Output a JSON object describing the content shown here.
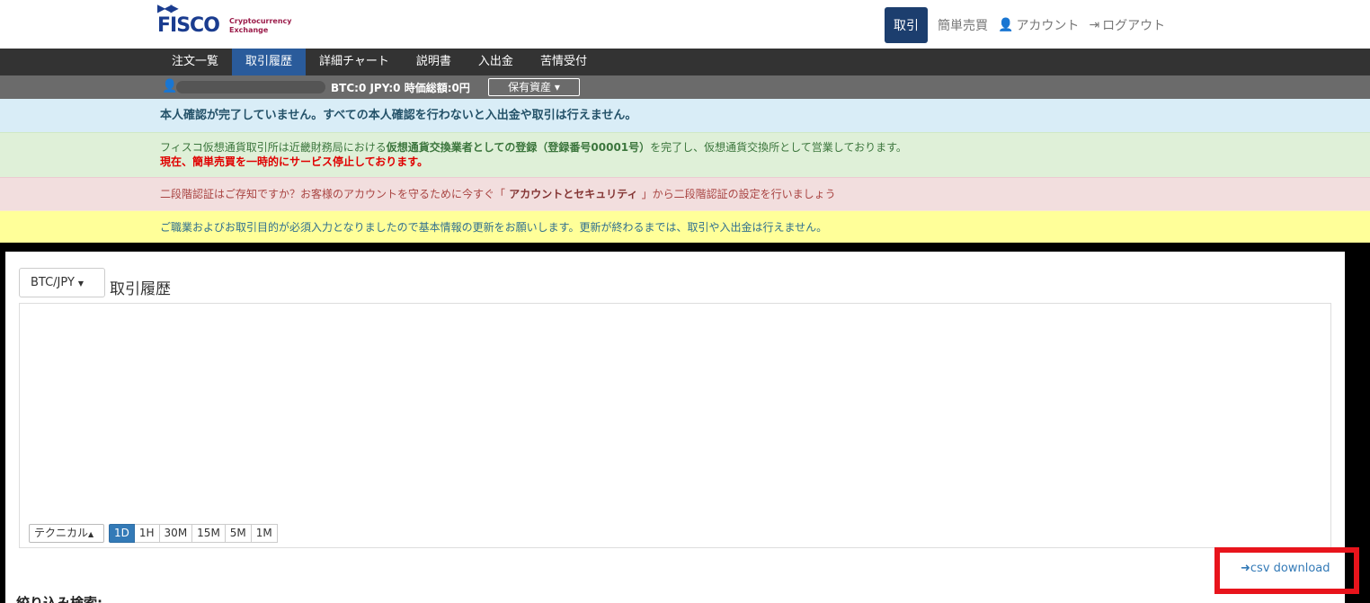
{
  "header": {
    "logo_text": "FISCO",
    "logo_sub_line1": "Cryptocurrency",
    "logo_sub_line2": "Exchange",
    "nav": {
      "trade": "取引",
      "simple": "簡単売買",
      "account": "アカウント",
      "logout": "ログアウト"
    }
  },
  "menu": {
    "items": [
      {
        "label": "注文一覧"
      },
      {
        "label": "取引履歴"
      },
      {
        "label": "詳細チャート"
      },
      {
        "label": "説明書"
      },
      {
        "label": "入出金"
      },
      {
        "label": "苦情受付"
      }
    ],
    "selected_index": 1
  },
  "status": {
    "balance": "BTC:0 JPY:0 時価総額:0円",
    "assets_button": "保有資産 ▾"
  },
  "alerts": {
    "info": "本人確認が完了していません。すべての本人確認を行わないと入出金や取引は行えません。",
    "success_pre": "フィスコ仮想通貨取引所は近畿財務局における",
    "success_strong": "仮想通貨交換業者としての登録（登録番号00001号）",
    "success_post": "を完了し、仮想通貨交換所として営業しております。",
    "success_red": "現在、簡単売買を一時的にサービス停止しております。",
    "danger_pre": "二段階認証はご存知ですか？お客様のアカウントを守るために今すぐ「",
    "danger_strong": " アカウントとセキュリティ ",
    "danger_post": "」から二段階認証の設定を行いましょう",
    "warning": "ご職業およびお取引目的が必須入力となりましたので基本情報の更新をお願いします。更新が終わるまでは、取引や入出金は行えません。"
  },
  "panel": {
    "pair": "BTC/JPY",
    "title": "取引履歴",
    "technical": "テクニカル",
    "timeframes": [
      "1D",
      "1H",
      "30M",
      "15M",
      "5M",
      "1M"
    ],
    "selected_timeframe": 0,
    "csv": "csv download",
    "filter_label": "絞り込み検索:"
  }
}
